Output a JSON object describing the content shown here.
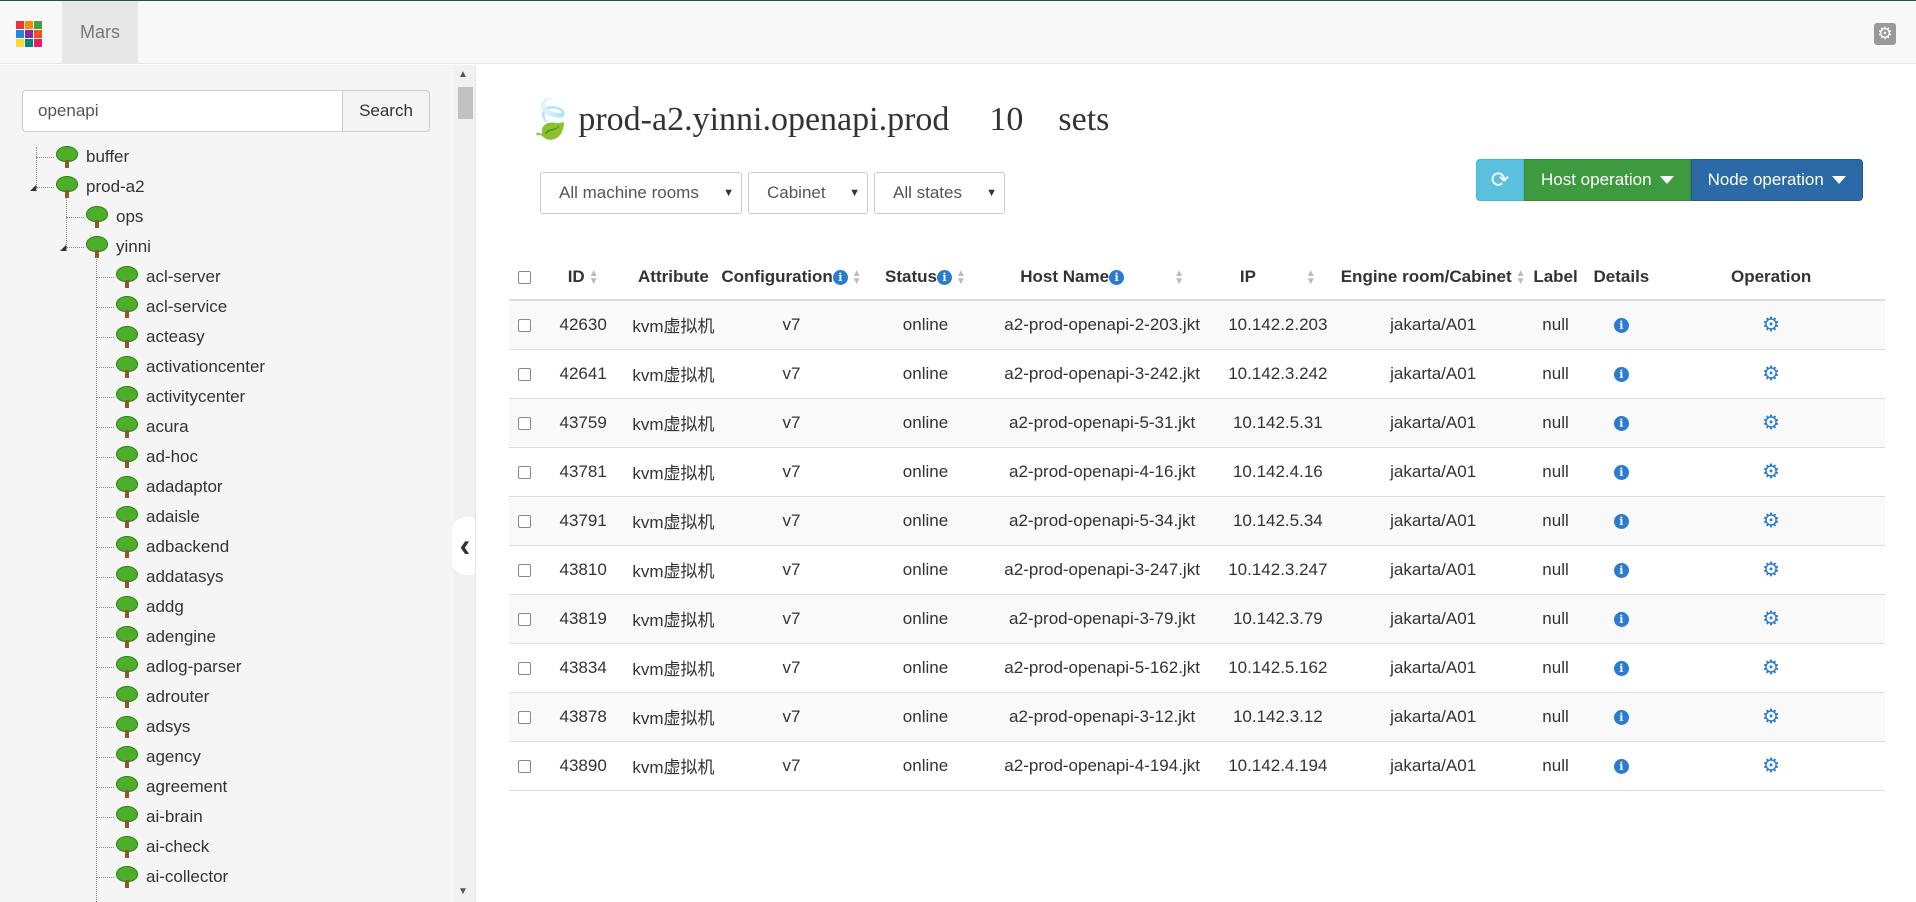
{
  "topbar": {
    "brand": "Mars",
    "apps_colors": [
      "#e53935",
      "#fb8c00",
      "#43a047",
      "#1e88e5",
      "#8e24aa",
      "#f4511e",
      "#fdd835",
      "#00897b",
      "#e91e63"
    ],
    "settings_icon": "gear-icon"
  },
  "sidebar": {
    "search": {
      "value": "openapi",
      "button": "Search"
    },
    "tree": [
      "buffer",
      "prod-a2",
      "ops",
      "yinni",
      "acl-server",
      "acl-service",
      "acteasy",
      "activationcenter",
      "activitycenter",
      "acura",
      "ad-hoc",
      "adadaptor",
      "adaisle",
      "adbackend",
      "addatasys",
      "addg",
      "adengine",
      "adlog-parser",
      "adrouter",
      "adsys",
      "agency",
      "agreement",
      "ai-brain",
      "ai-check",
      "ai-collector"
    ]
  },
  "main": {
    "title": "prod-a2.yinni.openapi.prod",
    "count": "10",
    "unit": "sets",
    "filters": [
      "All machine rooms",
      "Cabinet",
      "All states"
    ],
    "actions": {
      "host": "Host operation",
      "node": "Node operation"
    },
    "columns": [
      "ID",
      "Attribute",
      "Configuration",
      "Status",
      "Host Name",
      "IP",
      "Engine room/Cabinet",
      "Label",
      "Details",
      "Operation"
    ],
    "rows": [
      {
        "id": "42630",
        "attr": "kvm虚拟机",
        "config": "v7",
        "status": "online",
        "host": "a2-prod-openapi-2-203.jkt",
        "ip": "10.142.2.203",
        "room": "jakarta/A01",
        "label": "null"
      },
      {
        "id": "42641",
        "attr": "kvm虚拟机",
        "config": "v7",
        "status": "online",
        "host": "a2-prod-openapi-3-242.jkt",
        "ip": "10.142.3.242",
        "room": "jakarta/A01",
        "label": "null"
      },
      {
        "id": "43759",
        "attr": "kvm虚拟机",
        "config": "v7",
        "status": "online",
        "host": "a2-prod-openapi-5-31.jkt",
        "ip": "10.142.5.31",
        "room": "jakarta/A01",
        "label": "null"
      },
      {
        "id": "43781",
        "attr": "kvm虚拟机",
        "config": "v7",
        "status": "online",
        "host": "a2-prod-openapi-4-16.jkt",
        "ip": "10.142.4.16",
        "room": "jakarta/A01",
        "label": "null"
      },
      {
        "id": "43791",
        "attr": "kvm虚拟机",
        "config": "v7",
        "status": "online",
        "host": "a2-prod-openapi-5-34.jkt",
        "ip": "10.142.5.34",
        "room": "jakarta/A01",
        "label": "null"
      },
      {
        "id": "43810",
        "attr": "kvm虚拟机",
        "config": "v7",
        "status": "online",
        "host": "a2-prod-openapi-3-247.jkt",
        "ip": "10.142.3.247",
        "room": "jakarta/A01",
        "label": "null"
      },
      {
        "id": "43819",
        "attr": "kvm虚拟机",
        "config": "v7",
        "status": "online",
        "host": "a2-prod-openapi-3-79.jkt",
        "ip": "10.142.3.79",
        "room": "jakarta/A01",
        "label": "null"
      },
      {
        "id": "43834",
        "attr": "kvm虚拟机",
        "config": "v7",
        "status": "online",
        "host": "a2-prod-openapi-5-162.jkt",
        "ip": "10.142.5.162",
        "room": "jakarta/A01",
        "label": "null"
      },
      {
        "id": "43878",
        "attr": "kvm虚拟机",
        "config": "v7",
        "status": "online",
        "host": "a2-prod-openapi-3-12.jkt",
        "ip": "10.142.3.12",
        "room": "jakarta/A01",
        "label": "null"
      },
      {
        "id": "43890",
        "attr": "kvm虚拟机",
        "config": "v7",
        "status": "online",
        "host": "a2-prod-openapi-4-194.jkt",
        "ip": "10.142.4.194",
        "room": "jakarta/A01",
        "label": "null"
      }
    ]
  }
}
